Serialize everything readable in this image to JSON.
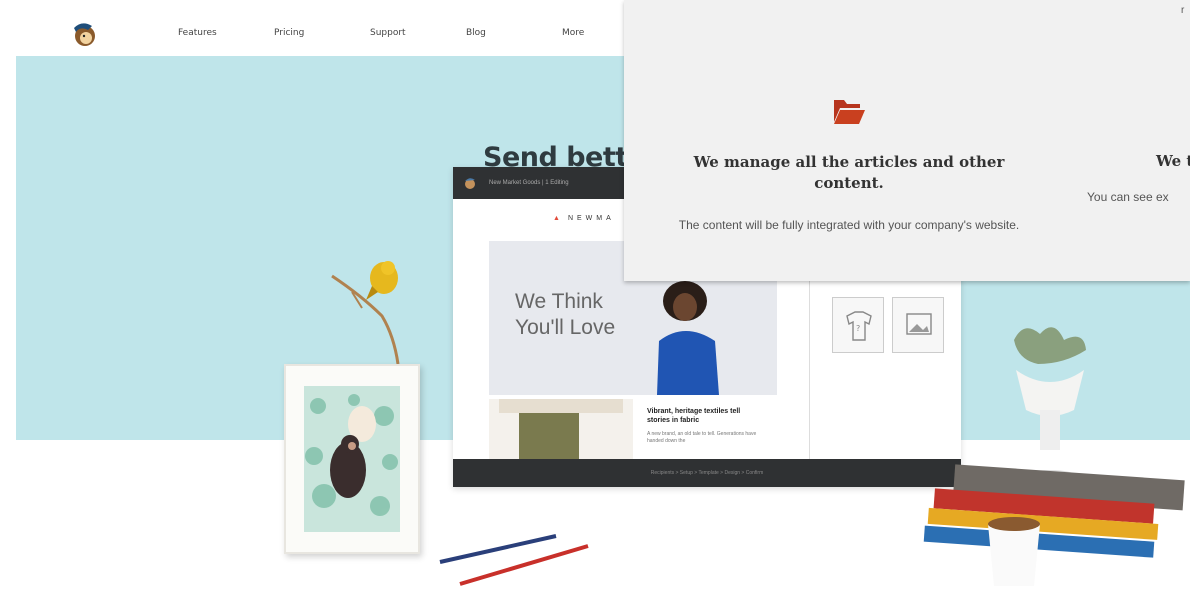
{
  "nav": {
    "items": [
      "Features",
      "Pricing",
      "Support",
      "Blog",
      "More"
    ]
  },
  "hero": {
    "title": "Send bette"
  },
  "monitor": {
    "title_bar": "New Market Goods  |  1 Editing",
    "brand": "NEWMA",
    "email_headline": "We Think You'll Love",
    "article_title": "Vibrant, heritage textiles tell stories in fabric",
    "article_body": "A new brand, an old tale to tell. Generations have handed down the",
    "steps": "Recipients  >  Setup  >  Template  >  Design  >  Confirm"
  },
  "overlay": {
    "corner_text": "r",
    "card1_title": "We manage all the articles and other content.",
    "card1_body": "The content will be fully integrated with your company's website.",
    "card2_title": "We t",
    "card2_body": "You can see ex"
  },
  "colors": {
    "hero_bg": "#bfe5ea",
    "accent": "#b7351e",
    "overlay_bg": "#f1f1f1"
  }
}
